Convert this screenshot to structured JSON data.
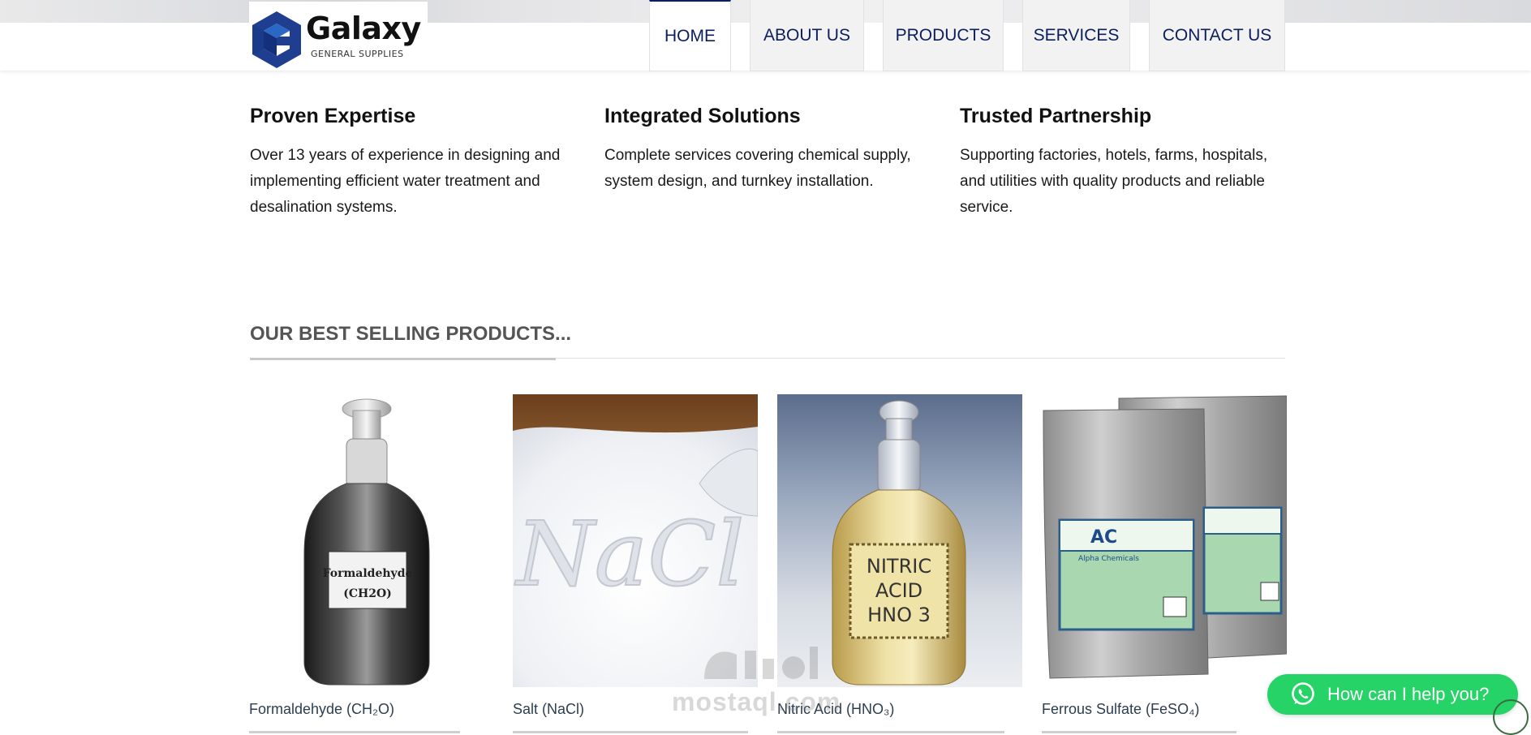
{
  "brand": {
    "name": "Galaxy",
    "tagline": "GENERAL SUPPLIES",
    "color_primary": "#0b1f5c",
    "color_logo_blue": "#1f3e8f",
    "color_logo_light": "#2b67c4"
  },
  "nav": {
    "items": [
      {
        "label": "HOME",
        "active": true
      },
      {
        "label": "ABOUT US",
        "active": false
      },
      {
        "label": "PRODUCTS",
        "active": false
      },
      {
        "label": "SERVICES",
        "active": false
      },
      {
        "label": "CONTACT US",
        "active": false
      }
    ]
  },
  "features": [
    {
      "title": "Proven Expertise",
      "text": "Over 13 years of experience in designing and implementing efficient water treatment and desalination systems."
    },
    {
      "title": "Integrated Solutions",
      "text": "Complete services covering chemical supply, system design, and turnkey installation."
    },
    {
      "title": "Trusted Partnership",
      "text": "Supporting factories, hotels, farms, hospitals, and utilities with quality products and reliable service."
    }
  ],
  "best_selling": {
    "title": "OUR BEST SELLING PRODUCTS...",
    "products": [
      {
        "name": "Formaldehyde (CH₂O)",
        "image_label_line1": "Formaldehyde",
        "image_label_line2": "(CH2O)",
        "image_icon": "glass-bottle-clear"
      },
      {
        "name": "Salt (NaCl)",
        "image_text": "NaCl",
        "image_icon": "salt-spill"
      },
      {
        "name": "Nitric Acid (HNO₃)",
        "image_label_line1": "NITRIC",
        "image_label_line2": "ACID",
        "image_label_line3": "HNO 3",
        "image_icon": "glass-bottle-yellow"
      },
      {
        "name": "Ferrous Sulfate (FeSO₄)",
        "image_label": "AC",
        "image_label_sub": "Alpha Chemicals",
        "image_icon": "chemical-pouch"
      }
    ]
  },
  "watermark": {
    "text": "mostaql.com"
  },
  "chat": {
    "label": "How can I help you?",
    "color": "#25d366"
  }
}
